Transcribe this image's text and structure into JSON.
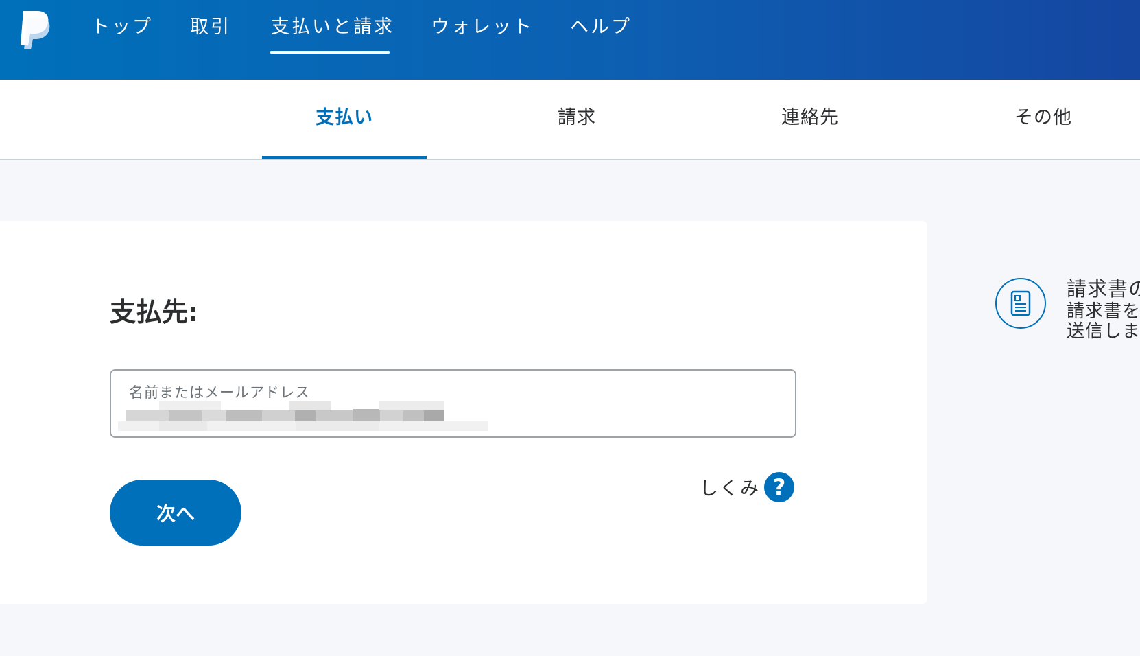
{
  "top_nav": {
    "logo": "paypal-logo",
    "items": [
      {
        "label": "トップ"
      },
      {
        "label": "取引"
      },
      {
        "label": "支払いと請求"
      },
      {
        "label": "ウォレット"
      },
      {
        "label": "ヘルプ"
      }
    ],
    "active_index": 2
  },
  "sub_nav": {
    "tabs": [
      {
        "label": "支払い"
      },
      {
        "label": "請求"
      },
      {
        "label": "連絡先"
      },
      {
        "label": "その他"
      }
    ],
    "active_index": 0
  },
  "payment_form": {
    "title": "支払先:",
    "recipient_label": "名前またはメールアドレス",
    "next_label": "次へ",
    "how_it_works_label": "しくみ",
    "help_icon": "question-circle-icon"
  },
  "side_promo": {
    "icon": "invoice-document-icon",
    "title": "請求書の",
    "text": "請求書を\n送信しま"
  },
  "colors": {
    "brand_blue": "#0070ba",
    "header_gradient_end": "#1546a0",
    "page_background": "#f5f7fa"
  }
}
